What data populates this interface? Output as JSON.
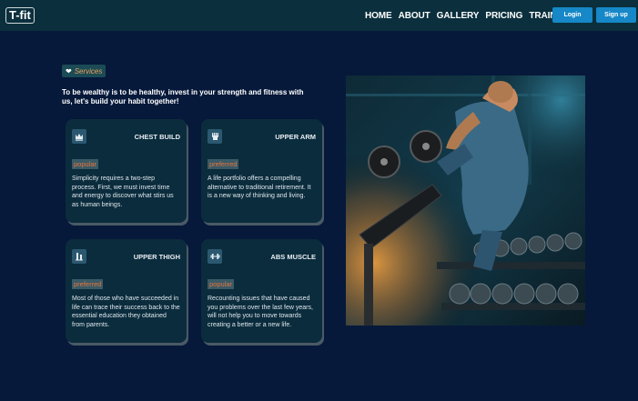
{
  "brand": {
    "logo": "T-fit"
  },
  "nav": {
    "links": [
      "HOME",
      "ABOUT",
      "GALLERY",
      "PRICING",
      "TRAINERS"
    ],
    "login": "Login",
    "signup": "Sign up"
  },
  "services": {
    "tag": "Services",
    "tagline": "To be wealthy is to be healthy, invest in your strength and fitness with us, let's build your habit together!"
  },
  "cards": [
    {
      "icon": "crown-icon",
      "title": "CHEST BUILD",
      "badge": "popular",
      "text": "Simplicity requires a two-step process. First, we must invest time and energy to discover what stirs us as human beings."
    },
    {
      "icon": "fist-icon",
      "title": "UPPER ARM",
      "badge": "preferred",
      "text": "A life portfolio offers a compelling alternative to traditional retirement. It is a new way of thinking and living."
    },
    {
      "icon": "leg-icon",
      "title": "UPPER THIGH",
      "badge": "preferred",
      "text": "Most of those who have succeeded in life can trace their success back to the essential education they obtained from parents."
    },
    {
      "icon": "dumbbell-icon",
      "title": "ABS MUSCLE",
      "badge": "popular",
      "text": "Recounting issues that have caused you problems over the last few years, will not help you to move towards creating a better or a new life."
    }
  ],
  "colors": {
    "nav_bg": "#0b2f3c",
    "page_bg": "#06193a",
    "button": "#1687c7",
    "badge_text": "#e8743a",
    "tag_text": "#f0a05a"
  }
}
